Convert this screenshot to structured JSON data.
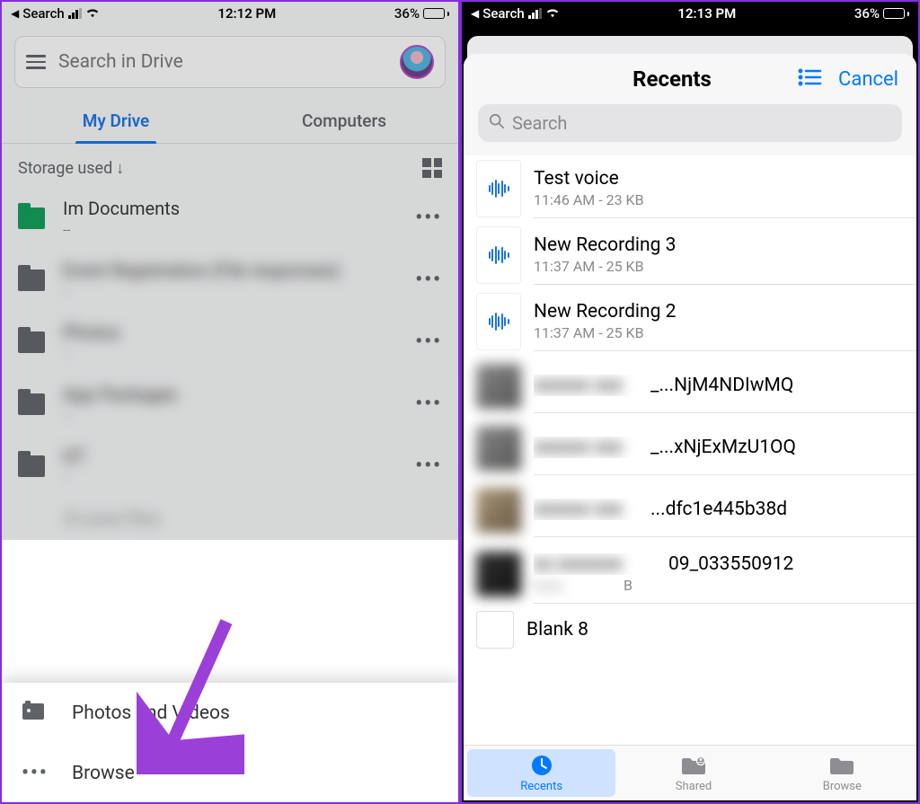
{
  "phone1": {
    "status": {
      "back_label": "Search",
      "time": "12:12 PM",
      "battery_pct": "36%"
    },
    "search_placeholder": "Search in Drive",
    "tabs": {
      "my_drive": "My Drive",
      "computers": "Computers"
    },
    "sort_label": "Storage used",
    "files": [
      {
        "name": "Im Documents",
        "sub": "--",
        "color": "green"
      },
      {
        "name": "Event Registration (File responses)",
        "sub": "--",
        "color": "gray",
        "blurred": true
      },
      {
        "name": "Photos",
        "sub": "--",
        "color": "gray",
        "blurred": true
      },
      {
        "name": "App Packages",
        "sub": "--",
        "color": "gray",
        "blurred": true
      },
      {
        "name": "GT",
        "sub": "--",
        "color": "gray",
        "blurred": true
      },
      {
        "name": "Ot pixel files",
        "sub": "",
        "color": "none",
        "partial": true
      }
    ],
    "sheet": {
      "photos_videos": "Photos and Videos",
      "browse": "Browse"
    }
  },
  "phone2": {
    "status": {
      "back_label": "Search",
      "time": "12:13 PM",
      "battery_pct": "36%"
    },
    "header": {
      "title": "Recents",
      "cancel": "Cancel"
    },
    "search_placeholder": "Search",
    "files": [
      {
        "name": "Test voice",
        "sub": "11:46 AM - 23 KB",
        "kind": "audio"
      },
      {
        "name": "New Recording 3",
        "sub": "11:37 AM - 25 KB",
        "kind": "audio"
      },
      {
        "name": "New Recording 2",
        "sub": "11:37 AM - 25 KB",
        "kind": "audio"
      },
      {
        "name": "_...NjM4NDIwMQ",
        "sub": "",
        "kind": "img",
        "blurred": true
      },
      {
        "name": "_...xNjExMzU1OQ",
        "sub": "",
        "kind": "img",
        "blurred": true
      },
      {
        "name": "...dfc1e445b38d",
        "sub": "",
        "kind": "img",
        "blurred": true
      },
      {
        "name": "09_033550912",
        "sub": "B",
        "kind": "img",
        "blurred": true
      },
      {
        "name": "Blank 8",
        "sub": "",
        "kind": "img"
      }
    ],
    "tabbar": {
      "recents": "Recents",
      "shared": "Shared",
      "browse": "Browse"
    }
  }
}
